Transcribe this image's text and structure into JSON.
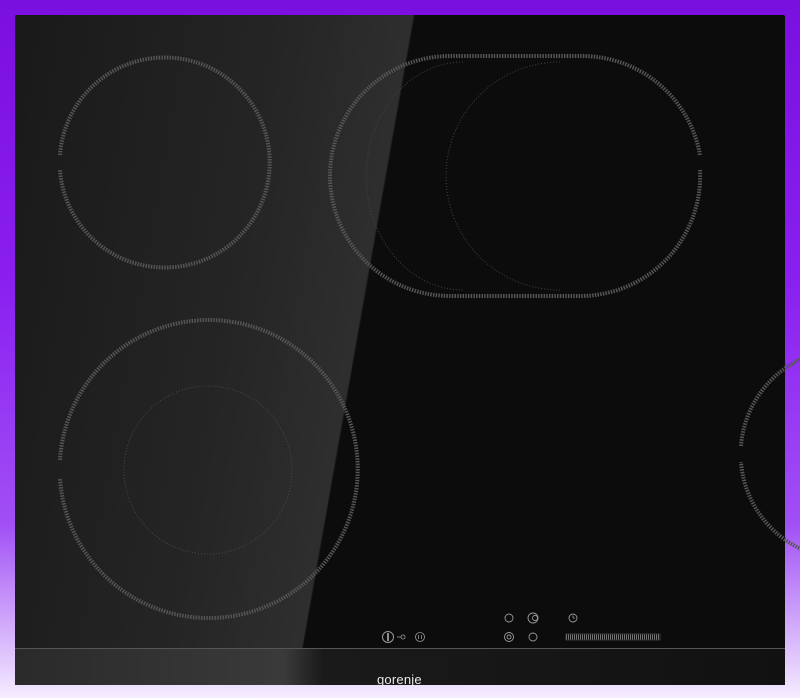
{
  "product": {
    "brand": "gorenje",
    "type": "ceramic-cooktop"
  },
  "cooking_zones": [
    {
      "id": "rear-left",
      "shape": "circle"
    },
    {
      "id": "rear-right-oval",
      "shape": "oval-dual"
    },
    {
      "id": "front-left-dual",
      "shape": "circle-dual"
    },
    {
      "id": "front-right",
      "shape": "circle"
    }
  ],
  "controls": {
    "power_icon": "power-icon",
    "lock_icon": "key-lock-icon",
    "pause_icon": "pause-icon",
    "zone_select_icons": [
      "circle-icon",
      "dual-circle-icon",
      "timer-icon",
      "ring-icon",
      "circle-icon"
    ],
    "slider": "power-slider"
  },
  "colors": {
    "glass": "#0c0c0c",
    "ring": "#5a5a5a",
    "inner_ring": "#4a4a4a",
    "frame": "#7a0fe0"
  }
}
